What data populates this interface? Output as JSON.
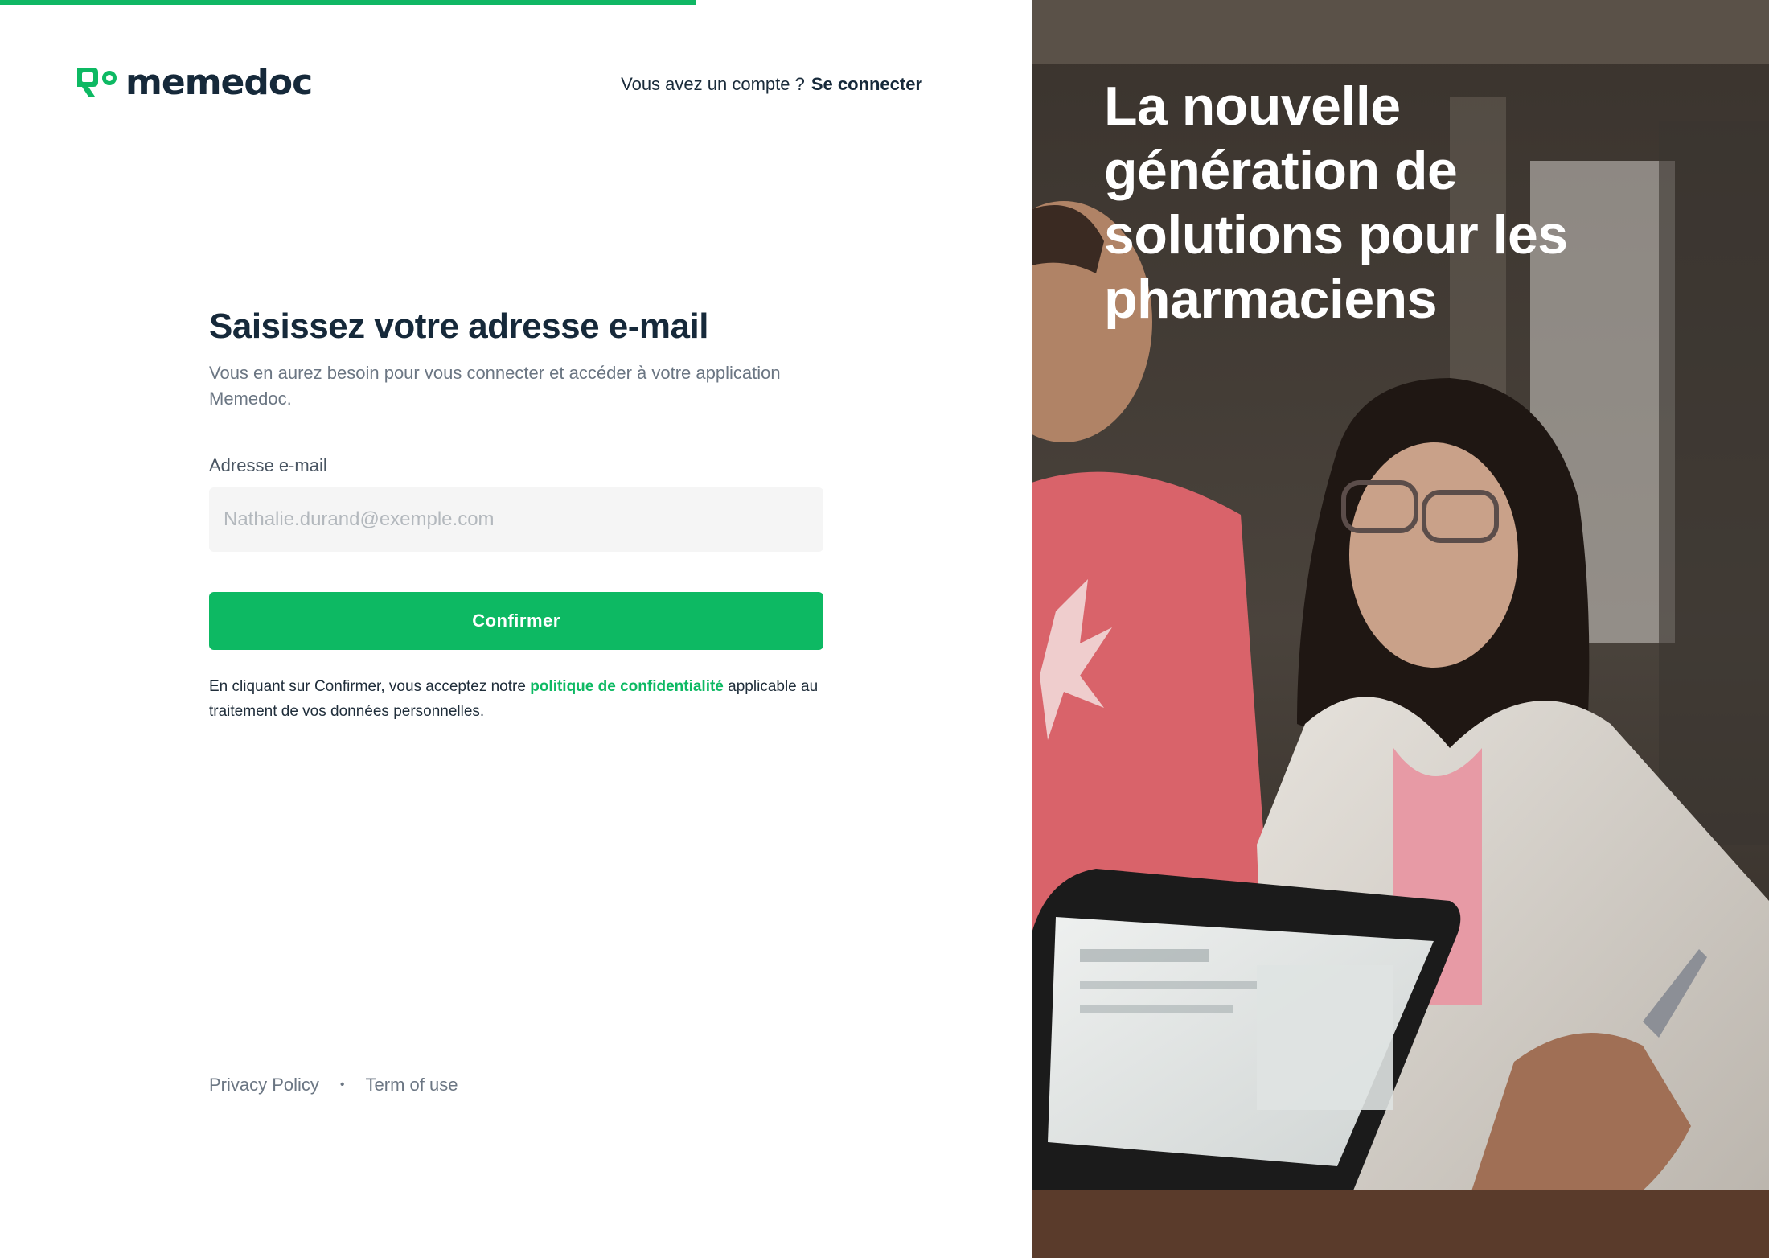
{
  "progress": {
    "fraction": 0.675
  },
  "brand": {
    "name": "memedoc",
    "logo_icon": "leaf-logo-icon",
    "accent_color": "#0db963"
  },
  "header": {
    "account_question": "Vous avez un compte ?",
    "signin_link": "Se connecter"
  },
  "form": {
    "title": "Saisissez votre adresse e-mail",
    "subtitle": "Vous en aurez besoin pour vous connecter et accéder à votre application Memedoc.",
    "email_label": "Adresse e-mail",
    "email_placeholder": "Nathalie.durand@exemple.com",
    "email_value": "",
    "confirm_label": "Confirmer",
    "legal_before": "En cliquant sur Confirmer, vous acceptez notre ",
    "legal_link": "politique de confidentialité",
    "legal_after": " applicable au traitement de vos données personnelles."
  },
  "footer": {
    "privacy": "Privacy Policy",
    "separator": "•",
    "terms": "Term of use"
  },
  "hero": {
    "headline": "La nouvelle génération de solutions pour les pharmaciens"
  }
}
